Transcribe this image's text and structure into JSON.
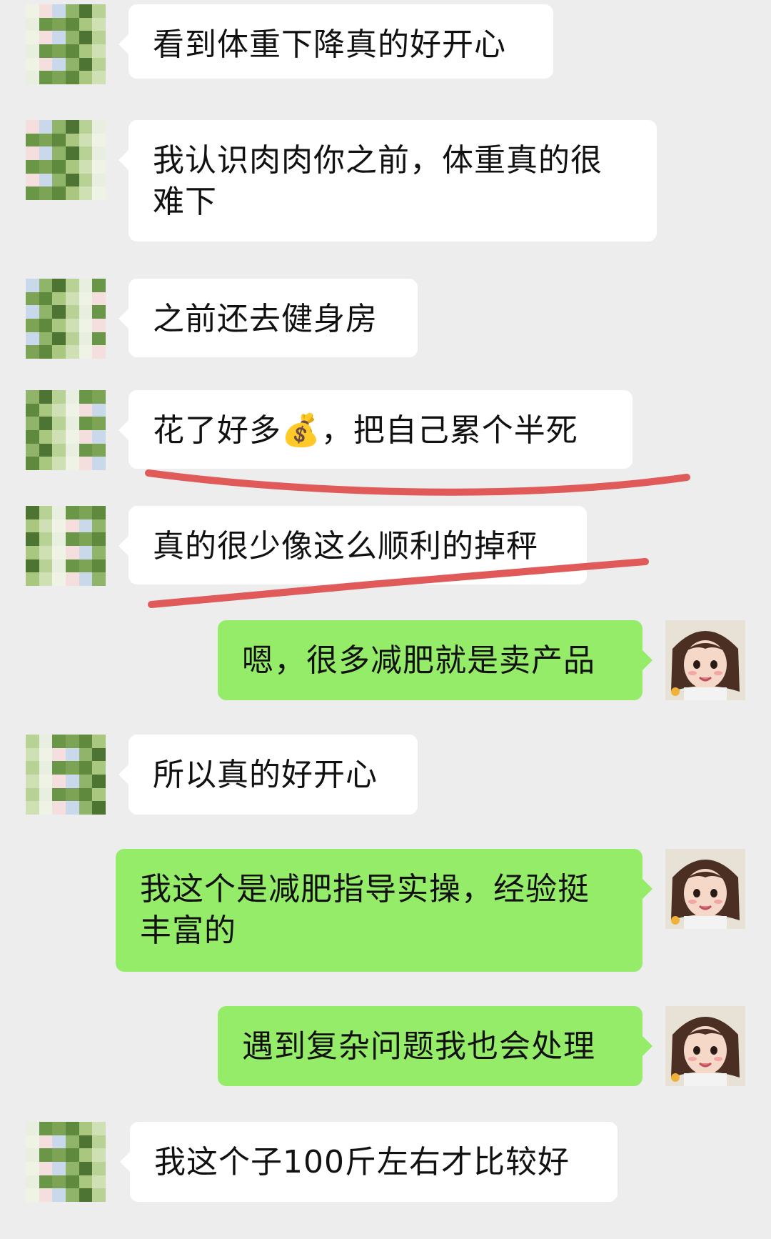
{
  "messages": [
    {
      "side": "left",
      "text": "看到体重下降真的好开心"
    },
    {
      "side": "left",
      "text": "我认识肉肉你之前，体重真的很难下"
    },
    {
      "side": "left",
      "text": "之前还去健身房"
    },
    {
      "side": "left",
      "text_before": "花了好多",
      "emoji": "💰",
      "text_after": "，把自己累个半死"
    },
    {
      "side": "left",
      "text": "真的很少像这么顺利的掉秤"
    },
    {
      "side": "right",
      "text": "嗯，很多减肥就是卖产品"
    },
    {
      "side": "left",
      "text": "所以真的好开心"
    },
    {
      "side": "right",
      "text": "我这个是减肥指导实操，经验挺丰富的"
    },
    {
      "side": "right",
      "text": "遇到复杂问题我也会处理"
    },
    {
      "side": "left",
      "text": "我这个子100斤左右才比较好"
    }
  ],
  "colors": {
    "background": "#ededed",
    "incoming_bubble": "#ffffff",
    "outgoing_bubble": "#95ec69",
    "annotation_stroke": "#e05a5a"
  },
  "icons": {
    "money_bag": "money-bag-emoji",
    "contact_avatar": "pixelated-avatar",
    "self_avatar": "cartoon-girl-avatar"
  }
}
